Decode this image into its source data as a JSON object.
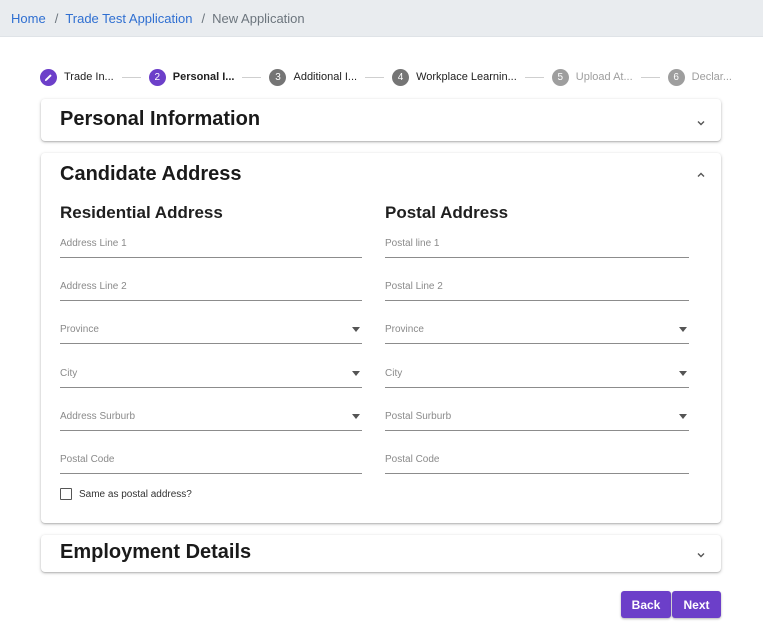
{
  "breadcrumb": {
    "items": [
      {
        "label": "Home"
      },
      {
        "label": "Trade Test Application"
      },
      {
        "label": "New Application"
      }
    ],
    "separator": "/"
  },
  "stepper": {
    "steps": [
      {
        "number": "",
        "label": "Trade In...",
        "state": "done",
        "icon": "pencil-icon"
      },
      {
        "number": "2",
        "label": "Personal I...",
        "state": "active"
      },
      {
        "number": "3",
        "label": "Additional I...",
        "state": "todo"
      },
      {
        "number": "4",
        "label": "Workplace Learnin...",
        "state": "todo"
      },
      {
        "number": "5",
        "label": "Upload At...",
        "state": "dim"
      },
      {
        "number": "6",
        "label": "Declar...",
        "state": "dim"
      }
    ]
  },
  "panels": {
    "personal": {
      "title": "Personal Information",
      "icon": "chevron-down-icon"
    },
    "address": {
      "title": "Candidate Address",
      "icon": "chevron-up-icon",
      "residential": {
        "heading": "Residential Address",
        "fields": [
          "Address Line 1",
          "Address Line 2",
          "Province",
          "City",
          "Address Surburb",
          "Postal Code"
        ]
      },
      "postal": {
        "heading": "Postal Address",
        "fields": [
          "Postal line 1",
          "Postal Line 2",
          "Province",
          "City",
          "Postal Surburb",
          "Postal Code"
        ]
      },
      "same_as_postal": "Same as postal address?"
    },
    "employment": {
      "title": "Employment Details",
      "icon": "chevron-down-icon"
    }
  },
  "buttons": {
    "back": "Back",
    "next": "Next"
  },
  "colors": {
    "accent": "#6c3fc9",
    "link": "#2f6fd1"
  }
}
